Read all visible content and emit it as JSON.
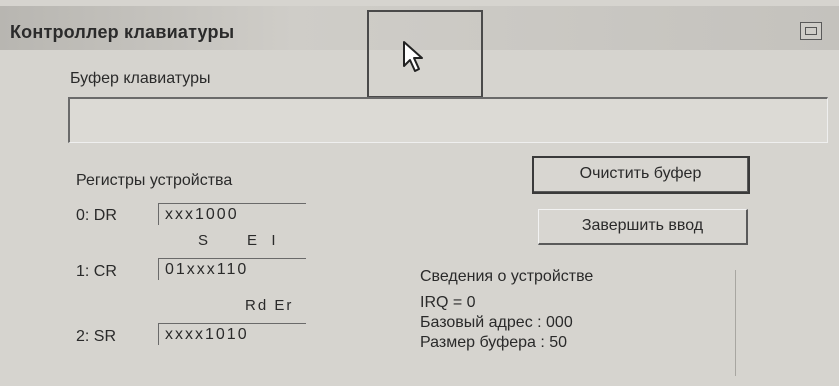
{
  "window": {
    "title": "Контроллер клавиатуры"
  },
  "buffer": {
    "label": "Буфер клавиатуры",
    "value": ""
  },
  "registers": {
    "heading": "Регистры устройства",
    "dr": {
      "label": "0: DR",
      "value": "xxx1000"
    },
    "cr": {
      "label": "1: CR",
      "bits_label": "S      E  I",
      "value": "01xxx110"
    },
    "sr": {
      "label": "2: SR",
      "bits_label": "Rd Er",
      "value": "xxxx1010"
    }
  },
  "buttons": {
    "clear_buffer": "Очистить буфер",
    "finish_input": "Завершить ввод"
  },
  "device_info": {
    "heading": "Сведения о устройстве",
    "irq": "IRQ = 0",
    "base_address": "Базовый адрес : 000",
    "buffer_size": "Размер буфера : 50"
  },
  "icons": {
    "cursor": "mouse-pointer-icon",
    "close": "close-icon"
  }
}
